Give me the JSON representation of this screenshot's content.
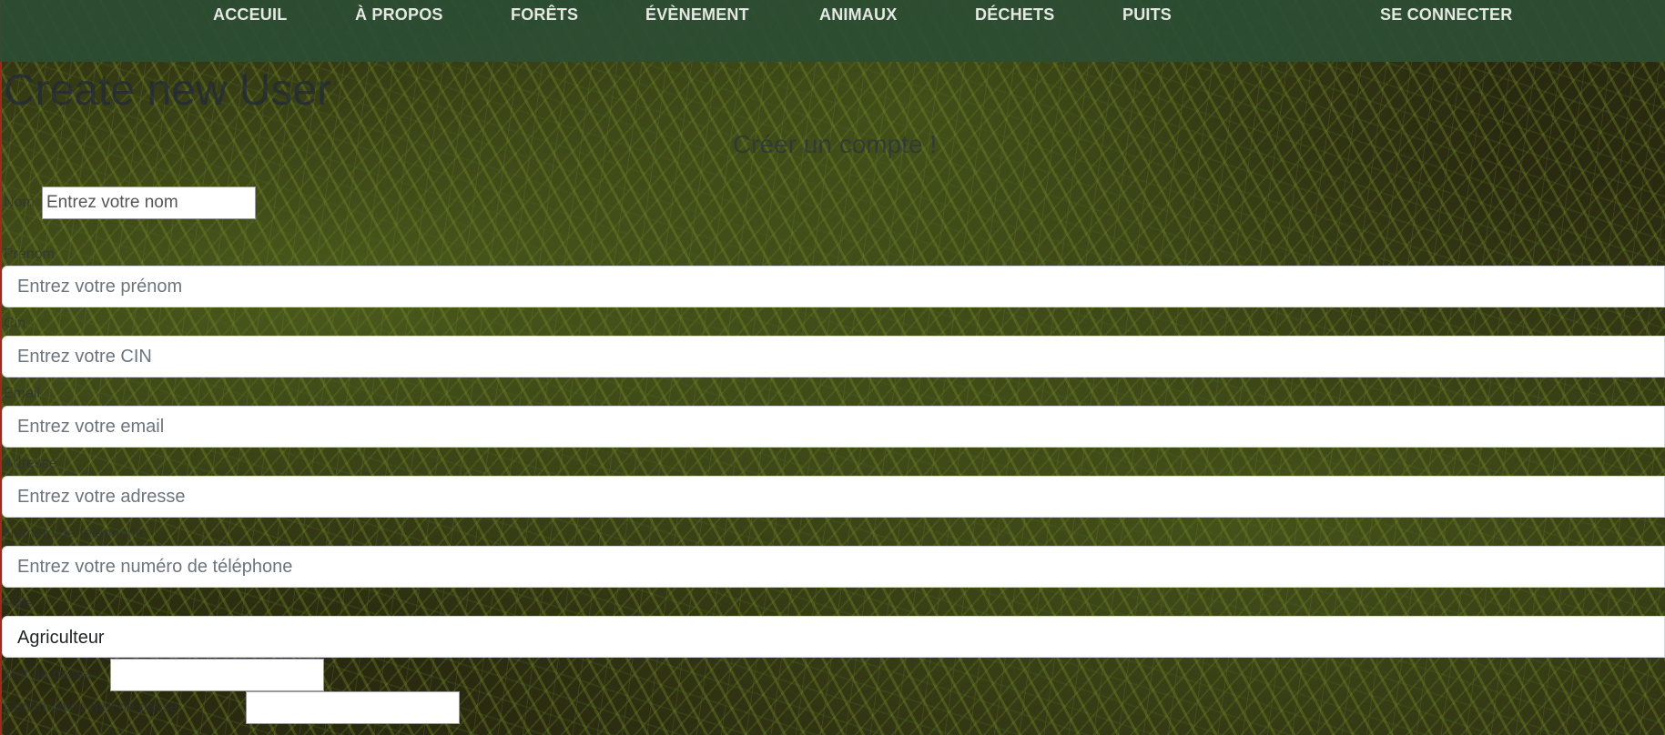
{
  "nav": {
    "items": [
      "ACCEUIL",
      "À PROPOS",
      "FORÊTS",
      "ÉVÈNEMENT",
      "ANIMAUX",
      "DÉCHETS",
      "PUITS"
    ],
    "login": "SE CONNECTER"
  },
  "page": {
    "title": "Create new User",
    "subtitle": "Créer un compte !"
  },
  "form": {
    "nom": {
      "label": "Nom",
      "placeholder": "Entrez votre nom"
    },
    "prenom": {
      "label": "Prénom",
      "placeholder": "Entrez votre prénom"
    },
    "cin": {
      "label": "Cin",
      "placeholder": "Entrez votre CIN"
    },
    "email": {
      "label": "Email",
      "placeholder": "Entrez votre email"
    },
    "adresse": {
      "label": "Adresse",
      "placeholder": "Entrez votre adresse"
    },
    "telephone": {
      "label": "Numéro de téléphone",
      "placeholder": "Entrez votre numéro de téléphone"
    },
    "role": {
      "label": "Rôle",
      "value": "Agriculteur"
    },
    "password": {
      "label": "Mot de passe"
    },
    "confirm_password": {
      "label": "Confirmation mot de passe"
    }
  }
}
